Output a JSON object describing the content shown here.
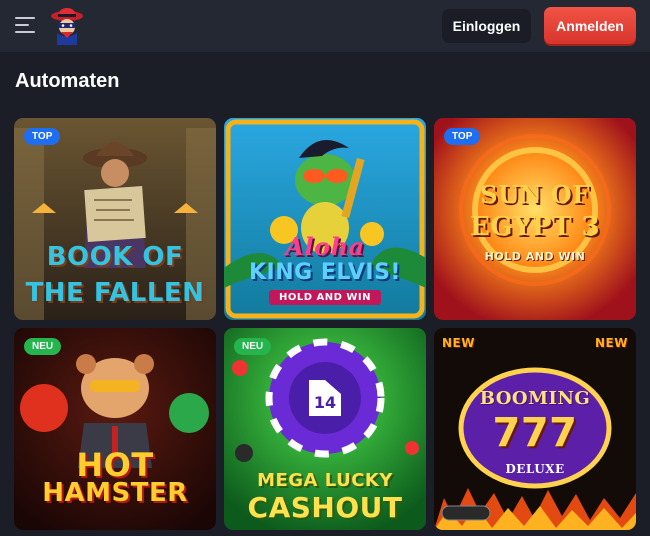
{
  "header": {
    "menu_icon": "hamburger-menu-icon",
    "logo_icon": "masked-bandit-logo-icon",
    "login_label": "Einloggen",
    "register_label": "Anmelden"
  },
  "section": {
    "title": "Automaten"
  },
  "games": [
    {
      "title_line1": "BOOK OF",
      "title_line2": "THE FALLEN",
      "badge": "TOP"
    },
    {
      "title_line1": "Aloha",
      "title_line2": "KING ELVIS!",
      "subtitle": "HOLD AND WIN",
      "badge": ""
    },
    {
      "title_line1": "SUN OF",
      "title_line2": "EGYPT 3",
      "subtitle": "HOLD AND WIN",
      "badge": "TOP"
    },
    {
      "title_line1": "HOT",
      "title_line2": "HAMSTER",
      "badge": "NEU"
    },
    {
      "title_line1": "MEGA LUCKY",
      "title_line2": "CASHOUT",
      "badge": "NEU"
    },
    {
      "title_line1": "BOOMING",
      "title_line2": "777",
      "subtitle": "DELUXE",
      "corner_label": "NEW",
      "badge": ""
    }
  ],
  "colors": {
    "background": "#1b1e27",
    "header": "#242833",
    "register_button": "#e8443a",
    "badge_top": "#1d6ef0",
    "badge_neu": "#26b44d"
  }
}
